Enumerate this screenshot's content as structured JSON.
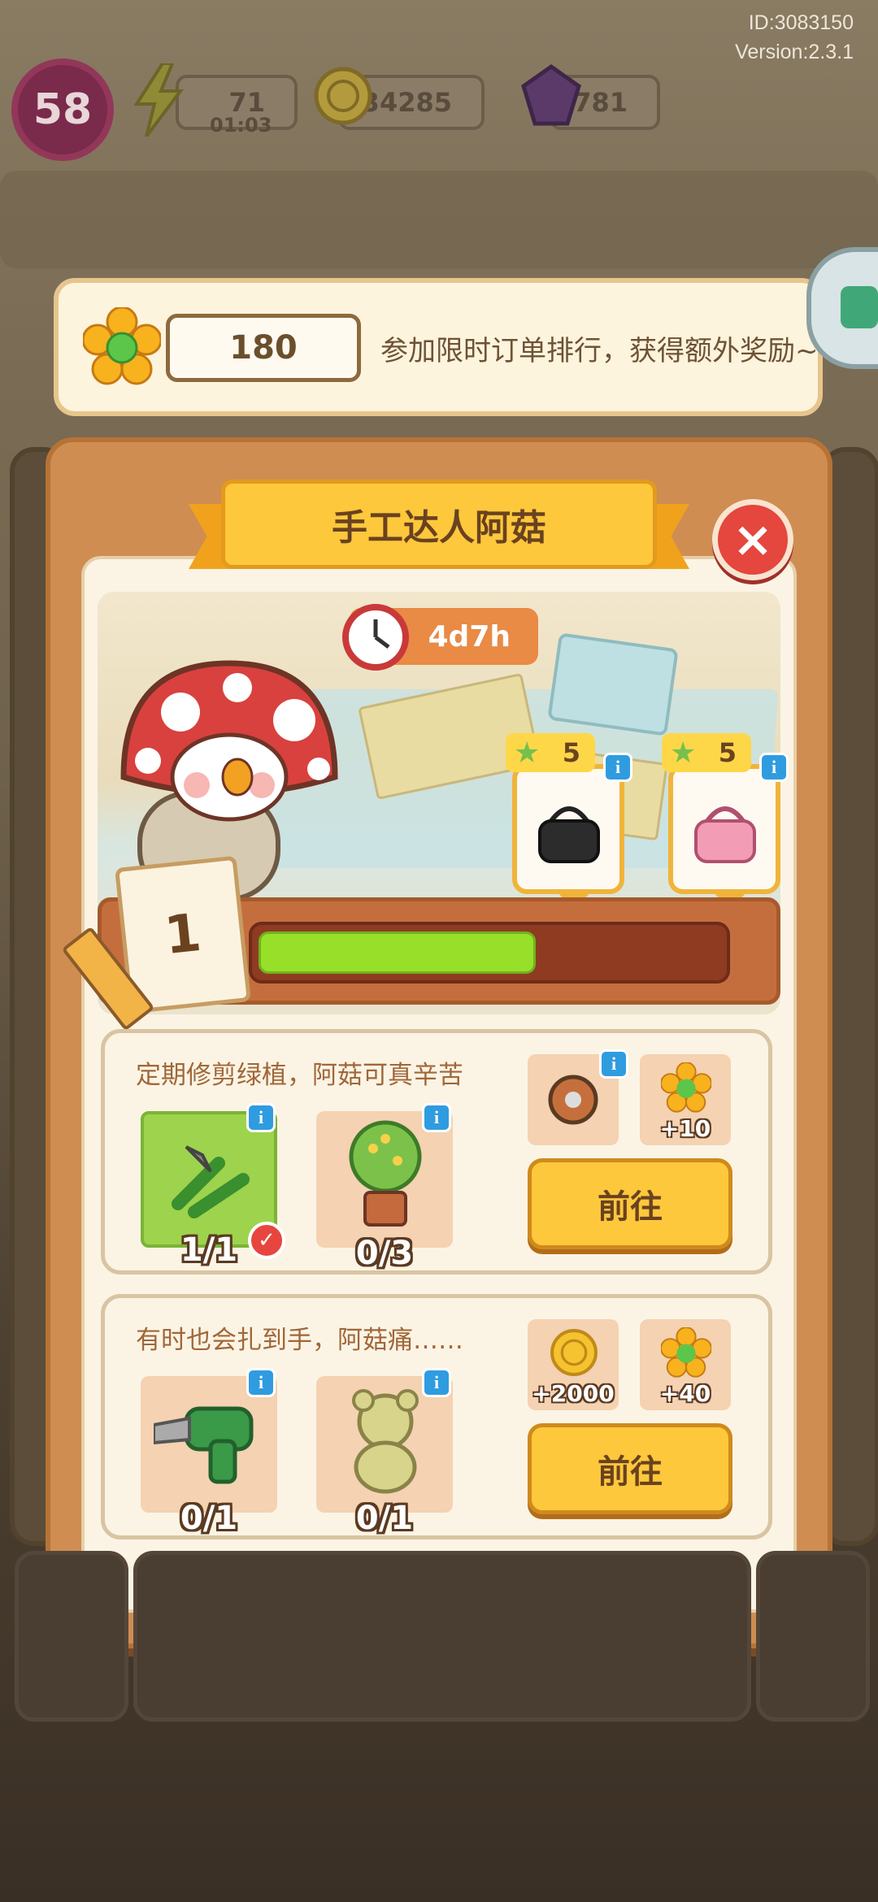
{
  "meta": {
    "id_text": "ID:3083150",
    "version_text": "Version:2.3.1"
  },
  "hud": {
    "level": "58",
    "energy": {
      "value": "71",
      "timer": "01:03"
    },
    "coins": {
      "value": "34285"
    },
    "gems": {
      "value": "781"
    }
  },
  "banner": {
    "points": "180",
    "message": "参加限时订单排行，获得额外奖励~"
  },
  "popup": {
    "title": "手工达人阿菇",
    "close_label": "×",
    "timer": "4d7h",
    "stage_number": "1",
    "progress_fraction": 0.6,
    "rewards_preview": [
      {
        "stars": "5",
        "item": "black-bag"
      },
      {
        "stars": "5",
        "item": "pink-bag"
      }
    ],
    "tasks": [
      {
        "description": "定期修剪绿植，阿菇可真辛苦",
        "requirements": [
          {
            "item": "pruning-shears",
            "count": "1/1",
            "completed": true
          },
          {
            "item": "potted-tree",
            "count": "0/3",
            "completed": false
          }
        ],
        "rewards": [
          {
            "item": "measuring-tape",
            "value": ""
          },
          {
            "item": "flower-points",
            "value": "+10"
          }
        ],
        "button_label": "前往"
      },
      {
        "description": "有时也会扎到手，阿菇痛……",
        "requirements": [
          {
            "item": "power-drill",
            "count": "0/1",
            "completed": false
          },
          {
            "item": "teddy-bear",
            "count": "0/1",
            "completed": false
          }
        ],
        "rewards": [
          {
            "item": "coin",
            "value": "+2000"
          },
          {
            "item": "flower-points",
            "value": "+40"
          }
        ],
        "button_label": "前往"
      }
    ]
  },
  "colors": {
    "accent_yellow": "#fdc83b",
    "progress_green": "#98df29",
    "close_red": "#e5463e",
    "info_blue": "#2f9ce0"
  }
}
